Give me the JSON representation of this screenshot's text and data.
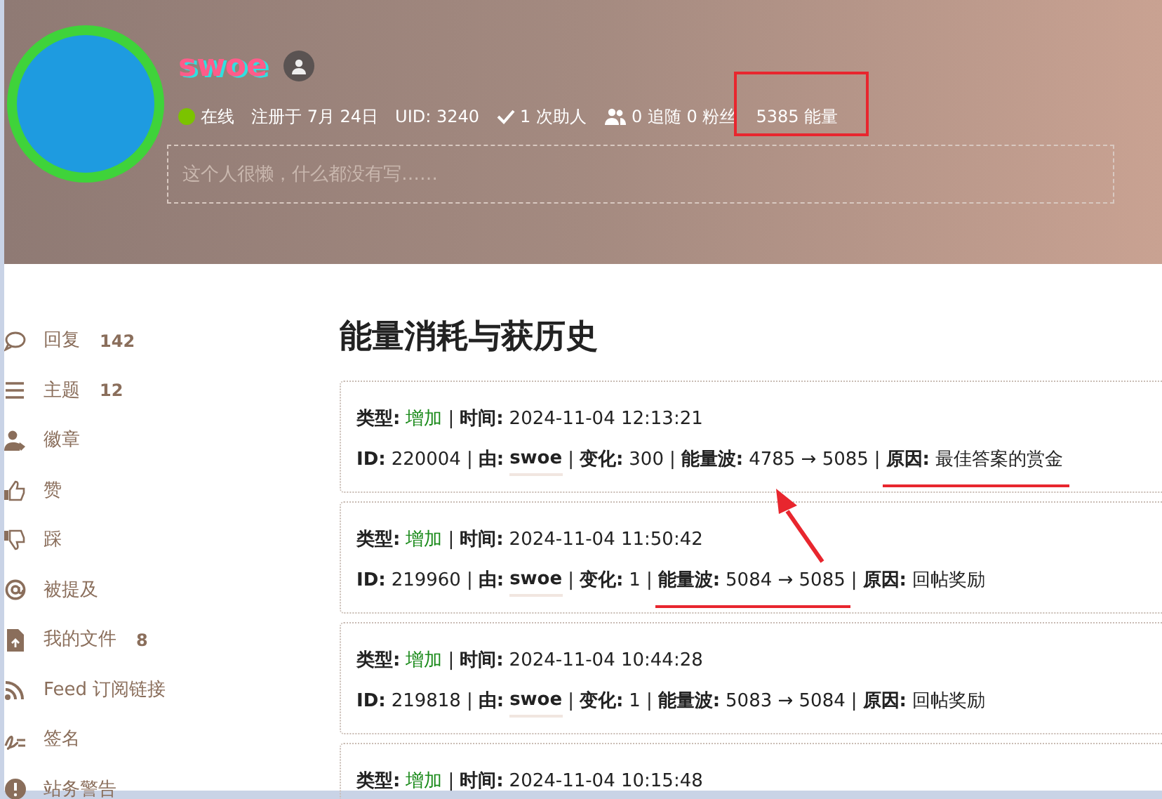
{
  "profile": {
    "username": "swoe",
    "stats": [
      {
        "kind": "status",
        "text": "在线",
        "highlighted": false
      },
      {
        "kind": "plain",
        "text": "注册于 7月 24日",
        "highlighted": false
      },
      {
        "kind": "plain",
        "text": "UID: 3240",
        "highlighted": false
      },
      {
        "kind": "check",
        "text": "1 次助人",
        "highlighted": false
      },
      {
        "kind": "users",
        "text": "0 追随 0 粉丝",
        "highlighted": false
      },
      {
        "kind": "plain",
        "text": "5385 能量",
        "highlighted": true
      }
    ],
    "bio": {
      "placeholder": "这个人很懒，什么都没有写……"
    }
  },
  "sidebar": {
    "items": [
      {
        "kind": "comment",
        "label": "回复",
        "count": "142"
      },
      {
        "kind": "list",
        "label": "主题",
        "count": "12"
      },
      {
        "kind": "badge",
        "label": "徽章"
      },
      {
        "kind": "thumb-up",
        "label": "赞"
      },
      {
        "kind": "thumb-down",
        "label": "踩"
      },
      {
        "kind": "at",
        "label": "被提及"
      },
      {
        "kind": "file",
        "label": "我的文件",
        "count": "8"
      },
      {
        "kind": "rss",
        "label": "Feed 订阅链接"
      },
      {
        "kind": "signature",
        "label": "签名"
      },
      {
        "kind": "warning",
        "label": "站务警告"
      }
    ]
  },
  "title": "能量消耗与获历史",
  "records": [
    {
      "lines": [
        [
          {
            "label": "类型:",
            "value": "增加",
            "kind": "type"
          },
          {
            "sep": "|",
            "label": "时间:",
            "value": "2024-11-04 12:13:21",
            "kind": "plain"
          }
        ],
        [
          {
            "label": "ID:",
            "value": "220004",
            "kind": "plain"
          },
          {
            "sep": "|",
            "label": "由:",
            "value": "swoe",
            "kind": "user"
          },
          {
            "sep": "|",
            "label": "变化:",
            "value": "300",
            "kind": "plain"
          },
          {
            "sep": "|",
            "label": "能量波:",
            "value": "4785 → 5085",
            "kind": "plain"
          },
          {
            "sep": "|",
            "label": "原因:",
            "value": "最佳答案的赏金",
            "kind": "plain",
            "underlined": true
          }
        ]
      ]
    },
    {
      "lines": [
        [
          {
            "label": "类型:",
            "value": "增加",
            "kind": "type"
          },
          {
            "sep": "|",
            "label": "时间:",
            "value": "2024-11-04 11:50:42",
            "kind": "plain"
          }
        ],
        [
          {
            "label": "ID:",
            "value": "219960",
            "kind": "plain"
          },
          {
            "sep": "|",
            "label": "由:",
            "value": "swoe",
            "kind": "user"
          },
          {
            "sep": "|",
            "label": "变化:",
            "value": "1",
            "kind": "plain"
          },
          {
            "sep": "|",
            "label": "能量波:",
            "value": "5084 → 5085",
            "kind": "plain",
            "underlined": true
          },
          {
            "sep": "|",
            "label": "原因:",
            "value": "回帖奖励",
            "kind": "plain"
          }
        ]
      ]
    },
    {
      "lines": [
        [
          {
            "label": "类型:",
            "value": "增加",
            "kind": "type"
          },
          {
            "sep": "|",
            "label": "时间:",
            "value": "2024-11-04 10:44:28",
            "kind": "plain"
          }
        ],
        [
          {
            "label": "ID:",
            "value": "219818",
            "kind": "plain"
          },
          {
            "sep": "|",
            "label": "由:",
            "value": "swoe",
            "kind": "user"
          },
          {
            "sep": "|",
            "label": "变化:",
            "value": "1",
            "kind": "plain"
          },
          {
            "sep": "|",
            "label": "能量波:",
            "value": "5083 → 5084",
            "kind": "plain"
          },
          {
            "sep": "|",
            "label": "原因:",
            "value": "回帖奖励",
            "kind": "plain"
          }
        ]
      ]
    },
    {
      "lines": [
        [
          {
            "label": "类型:",
            "value": "增加",
            "kind": "type"
          },
          {
            "sep": "|",
            "label": "时间:",
            "value": "2024-11-04 10:15:48",
            "kind": "plain"
          }
        ]
      ]
    }
  ],
  "annotations": {
    "arrow": true
  }
}
